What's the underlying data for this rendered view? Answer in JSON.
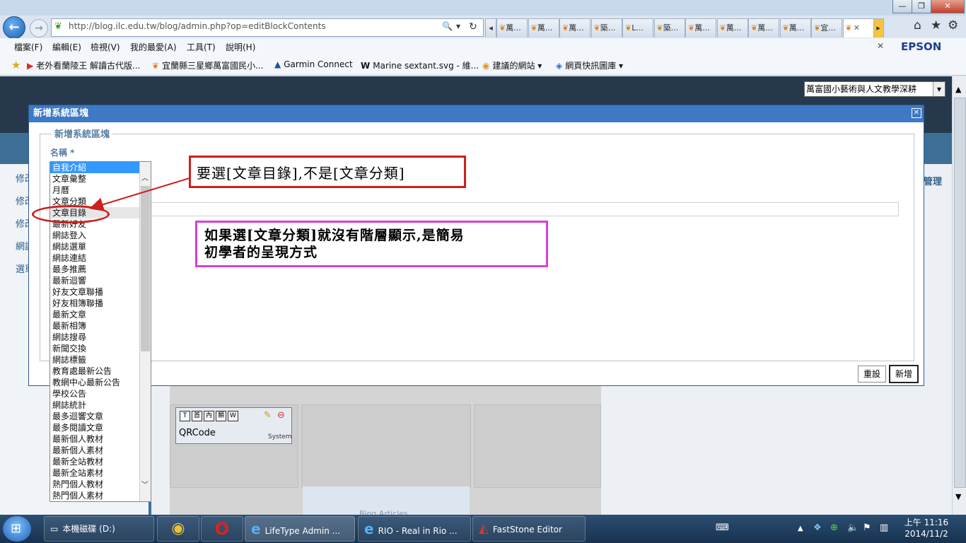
{
  "window": {
    "minimize": "—",
    "maximize": "❐",
    "close": "✕"
  },
  "nav": {
    "back": "←",
    "forward": "→",
    "url": "http://blog.ilc.edu.tw/blog/admin.php?op=editBlockContents",
    "search_icon": "🔍",
    "refresh_icon": "↻"
  },
  "tabs": [
    {
      "label": "萬..."
    },
    {
      "label": "萬..."
    },
    {
      "label": "萬..."
    },
    {
      "label": "築..."
    },
    {
      "label": "L..."
    },
    {
      "label": "築..."
    },
    {
      "label": "萬..."
    },
    {
      "label": "萬..."
    },
    {
      "label": "萬..."
    },
    {
      "label": "萬..."
    },
    {
      "label": "宜..."
    },
    {
      "label": "",
      "active": true
    }
  ],
  "toolbar_icons": {
    "home": "⌂",
    "favorites": "★",
    "tools": "⚙"
  },
  "menu": {
    "items": [
      "檔案(F)",
      "編輯(E)",
      "檢視(V)",
      "我的最愛(A)",
      "工具(T)",
      "說明(H)"
    ],
    "close_x": "✕",
    "epson": "EPSON"
  },
  "favorites": {
    "items": [
      {
        "label": "老外看蘭陵王 解讀古代版..."
      },
      {
        "label": "宜蘭縣三星鄉萬富國民小..."
      },
      {
        "label": "Garmin Connect"
      },
      {
        "label": "Marine sextant.svg - 維..."
      },
      {
        "label": "建議的網站 ▾"
      },
      {
        "label": "網頁快訊圖庫 ▾"
      }
    ]
  },
  "page": {
    "blog_select": "萬富國小藝術與人文教學深耕",
    "side_links": [
      "修改",
      "修改",
      "修改",
      "網誌",
      "選單"
    ],
    "manage_link": "管理",
    "qrcode": {
      "buttons": [
        "T",
        "首",
        "內",
        "類",
        "W"
      ],
      "label": "QRCode",
      "type": "System"
    },
    "blog_articles": "Blog Articles"
  },
  "dialog": {
    "title": "新增系統區塊",
    "close": "✕",
    "legend": "新增系統區塊",
    "name_label": "名稱 *",
    "reset_label": "重設",
    "add_label": "新增"
  },
  "listbox": {
    "selected_index": 0,
    "highlighted_index": 4,
    "options": [
      "自我介紹",
      "文章彙整",
      "月曆",
      "文章分類",
      "文章目錄",
      "最新好友",
      "網誌登入",
      "網誌選單",
      "網誌連結",
      "最多推薦",
      "最新迴響",
      "好友文章聯播",
      "好友相簿聯播",
      "最新文章",
      "最新相簿",
      "網誌搜尋",
      "新聞交換",
      "網誌標籤",
      "教育處最新公告",
      "教網中心最新公告",
      "學校公告",
      "網誌統計",
      "最多迴響文章",
      "最多閱讀文章",
      "最新個人教材",
      "最新個人素材",
      "最新全站教材",
      "最新全站素材",
      "熱門個人教材",
      "熱門個人素材"
    ]
  },
  "annotations": {
    "callout1": "要選[文章目錄],不是[文章分類]",
    "callout2_line1": "如果選[文章分類]就沒有階層顯示,是簡易",
    "callout2_line2": "初學者的呈現方式"
  },
  "taskbar": {
    "buttons": [
      {
        "label": "本機磁碟 (D:)"
      },
      {
        "label": ""
      },
      {
        "label": ""
      },
      {
        "label": "LifeType Admin ..."
      },
      {
        "label": "RIO - Real in Rio ..."
      },
      {
        "label": "FastStone Editor"
      }
    ],
    "clock_time": "上午 11:16",
    "clock_date": "2014/11/2"
  }
}
